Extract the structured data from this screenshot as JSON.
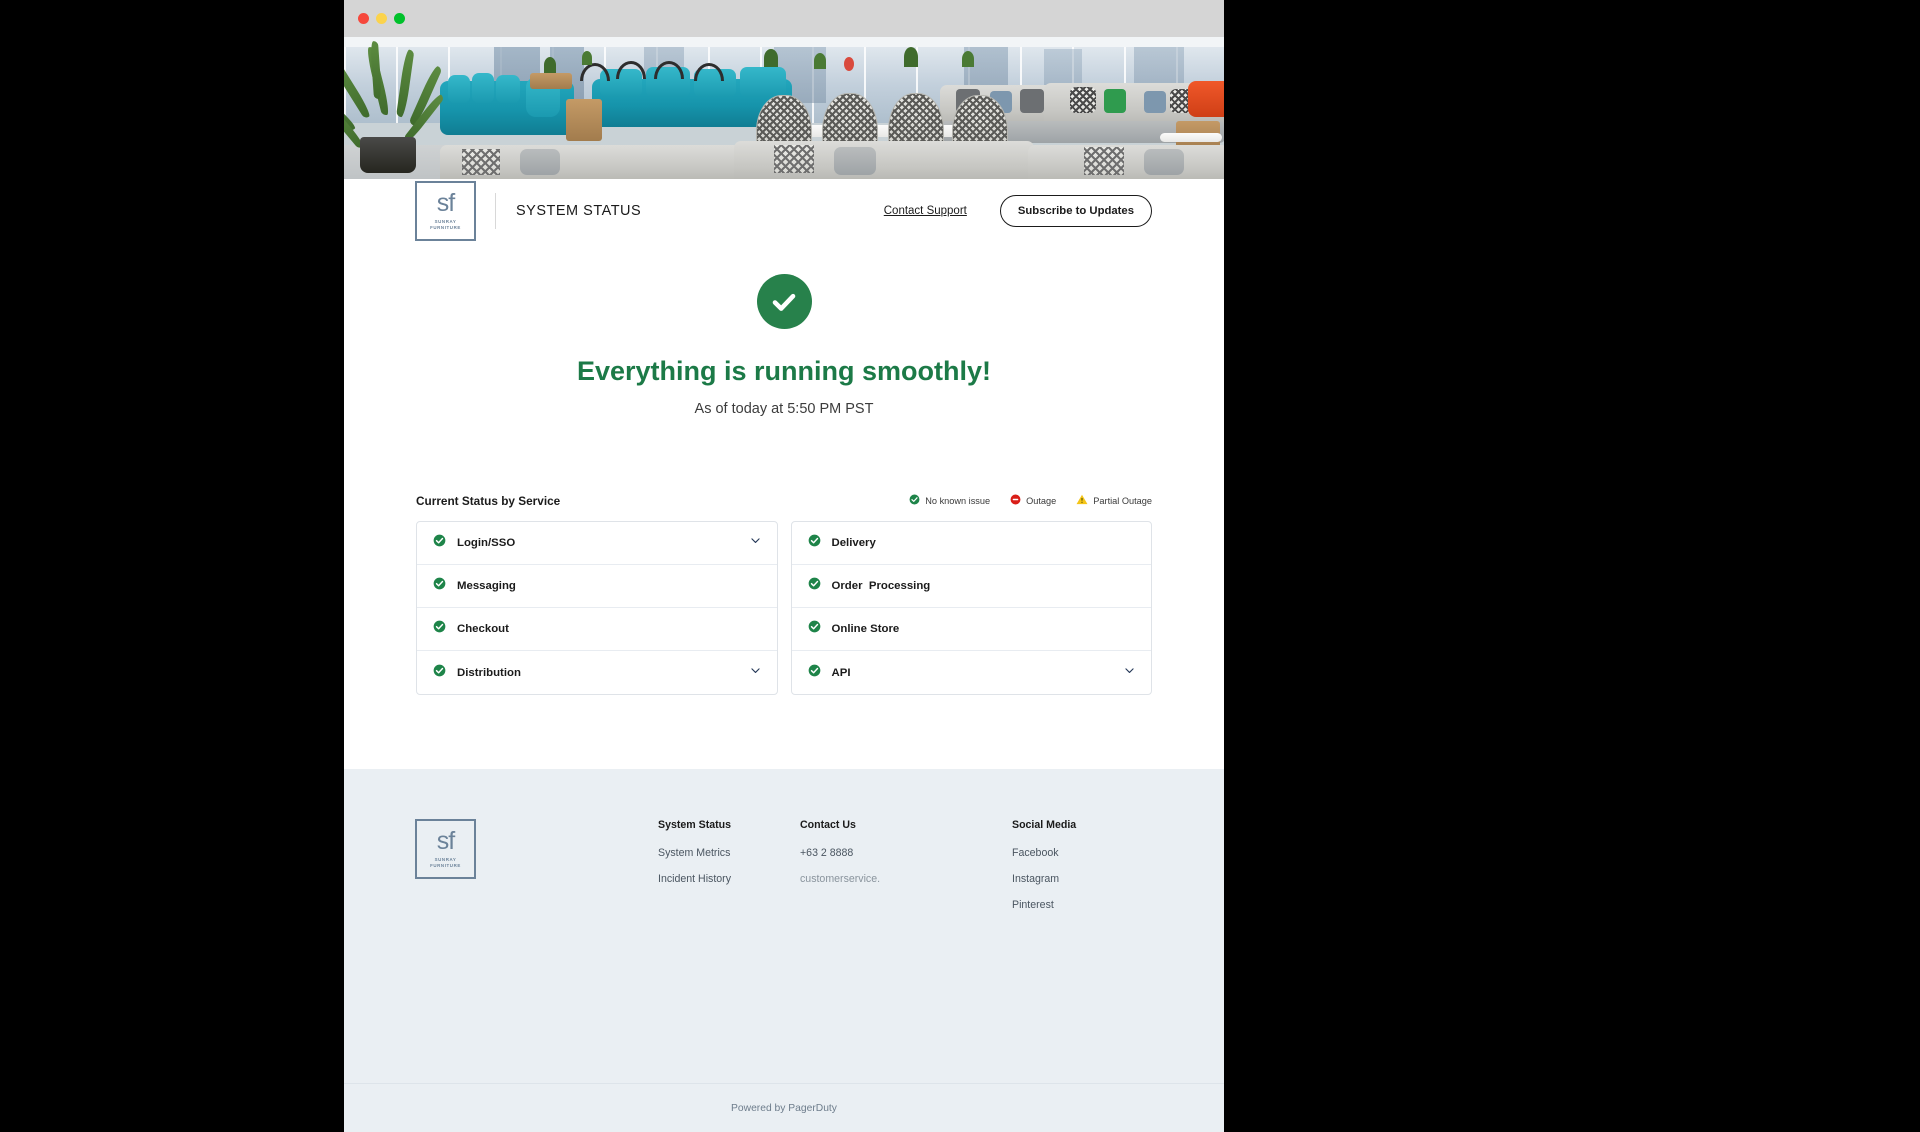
{
  "window": {
    "traffic_lights": [
      "close",
      "minimize",
      "maximize"
    ]
  },
  "header": {
    "logo_mark": "sf",
    "logo_line1": "SUNRAY",
    "logo_line2": "FURNITURE",
    "title": "SYSTEM STATUS",
    "contact_support": "Contact Support",
    "subscribe_button": "Subscribe to Updates"
  },
  "status_hero": {
    "icon": "check-circle-icon",
    "headline": "Everything is running smoothly!",
    "subtext": "As of today at 5:50 PM PST",
    "accent_color": "#1c7a47",
    "icon_color": "#27814b"
  },
  "services": {
    "title": "Current Status by Service",
    "legend": [
      {
        "icon": "check-circle-icon",
        "label": "No known issue",
        "color": "#1e8449"
      },
      {
        "icon": "outage-icon",
        "label": "Outage",
        "color": "#d91e18"
      },
      {
        "icon": "warning-triangle-icon",
        "label": "Partial Outage",
        "color": "#f5c518"
      }
    ],
    "left_column": [
      {
        "label": "Login/SSO",
        "status": "ok",
        "expandable": true
      },
      {
        "label": "Messaging",
        "status": "ok",
        "expandable": false
      },
      {
        "label": "Checkout",
        "status": "ok",
        "expandable": false
      },
      {
        "label": "Distribution",
        "status": "ok",
        "expandable": true
      }
    ],
    "right_column": [
      {
        "label": "Delivery",
        "status": "ok",
        "expandable": false
      },
      {
        "label": "Order  Processing",
        "status": "ok",
        "expandable": false
      },
      {
        "label": "Online Store",
        "status": "ok",
        "expandable": false
      },
      {
        "label": "API",
        "status": "ok",
        "expandable": true
      }
    ]
  },
  "footer": {
    "logo_mark": "sf",
    "logo_line1": "SUNRAY",
    "logo_line2": "FURNITURE",
    "columns": [
      {
        "title": "System Status",
        "items": [
          "System Metrics",
          "Incident History"
        ]
      },
      {
        "title": "Contact Us",
        "items": [
          "+63 2 8888",
          "customerservice."
        ]
      },
      {
        "title": "Social Media",
        "items": [
          "Facebook",
          "Instagram",
          "Pinterest"
        ]
      }
    ],
    "powered_by": "Powered by PagerDuty"
  }
}
